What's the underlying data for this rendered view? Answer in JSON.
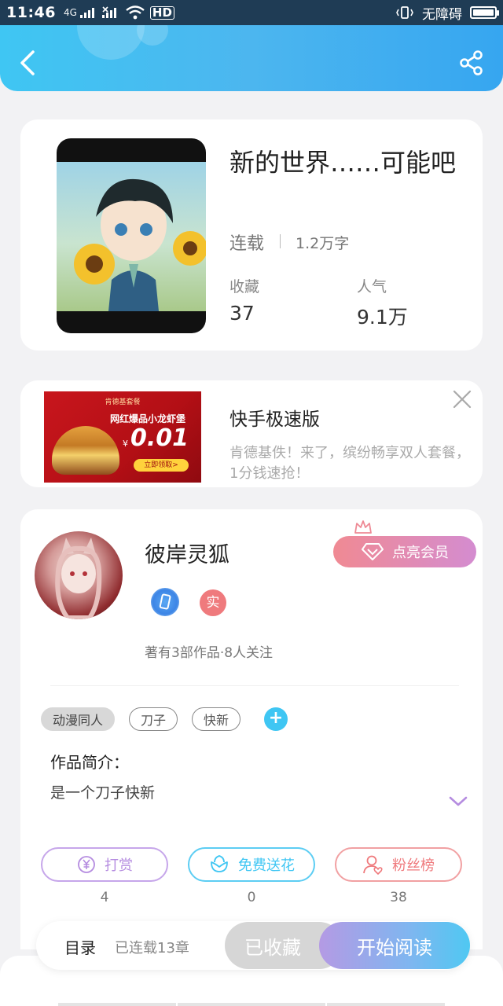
{
  "status_bar": {
    "time": "11:46",
    "signal": "4G",
    "network": "HD",
    "accessibility": "无障碍"
  },
  "colors": {
    "header_gradient_start": "#3fc6f3",
    "header_gradient_end": "#36a6f0",
    "vip_pink": "#f08a93",
    "reward_purple": "#b58ce0",
    "flower_cyan": "#3fc6f3",
    "fans_red": "#ef7a7d"
  },
  "book": {
    "title": "新的世界……可能吧",
    "status": "连载",
    "word_count": "1.2万字",
    "favorites_label": "收藏",
    "favorites_value": "37",
    "popularity_label": "人气",
    "popularity_value": "9.1万"
  },
  "ad": {
    "banner_header": "肯德基套餐",
    "banner_slogan": "网红爆品小龙虾堡",
    "banner_currency": "¥",
    "banner_price": "0.01",
    "banner_cta": "立即领取>",
    "title": "快手极速版",
    "description": "肯德基佚！来了，缤纷畅享双人套餐，1分钱速抢！"
  },
  "author": {
    "name": "彼岸灵狐",
    "real_badge": "实",
    "meta": "著有3部作品·8人关注",
    "vip_button": "点亮会员"
  },
  "tags": [
    {
      "label": "动漫同人"
    },
    {
      "label": "刀子"
    },
    {
      "label": "快新"
    }
  ],
  "tag_add": "+",
  "intro": {
    "label": "作品简介：",
    "text": "是一个刀子快新"
  },
  "actions": [
    {
      "label": "打赏",
      "count": "4",
      "icon": "yen-circle-icon"
    },
    {
      "label": "免费送花",
      "count": "0",
      "icon": "flower-icon"
    },
    {
      "label": "粉丝榜",
      "count": "38",
      "icon": "fan-user-icon"
    }
  ],
  "bottom_bar": {
    "toc_label": "目录",
    "chapters": "已连载13章",
    "collected_label": "已收藏",
    "read_label": "开始阅读"
  }
}
